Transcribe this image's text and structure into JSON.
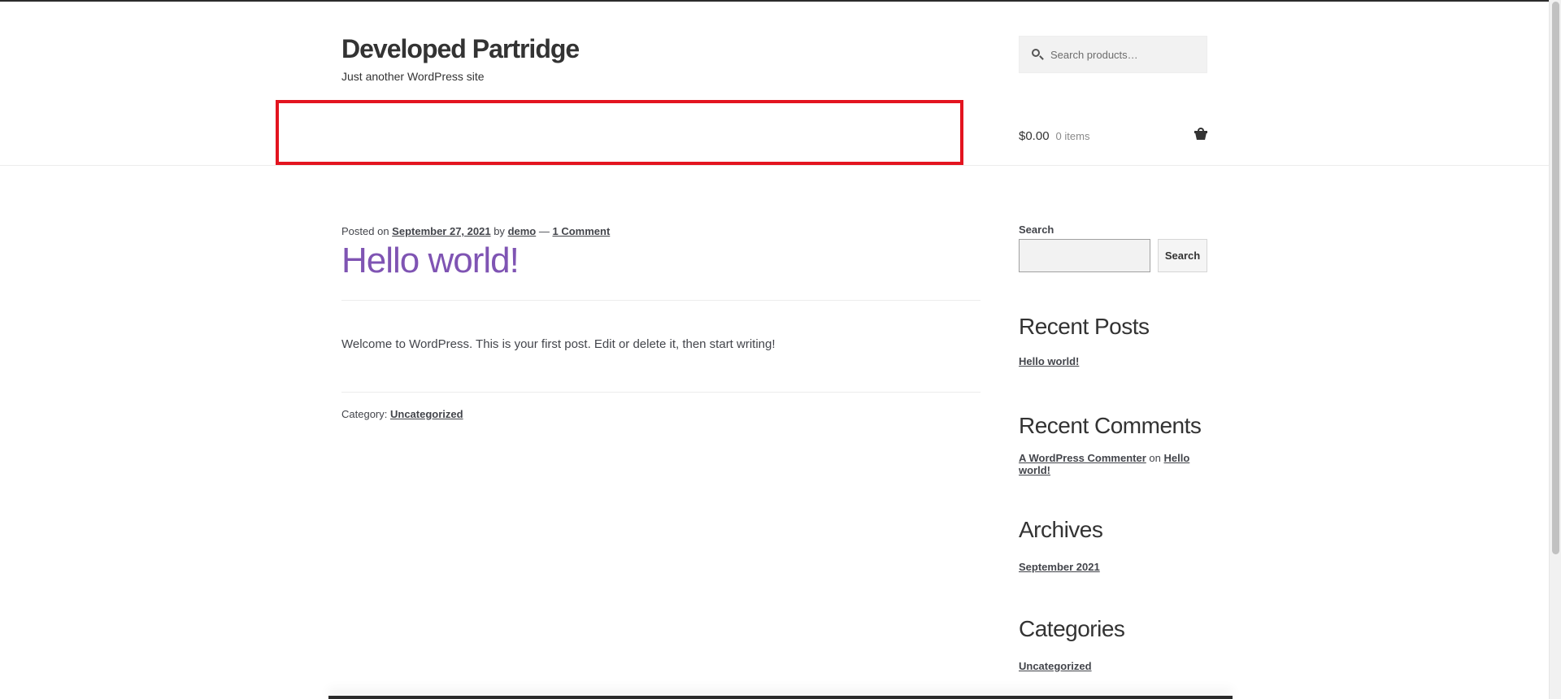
{
  "header": {
    "site_title": "Developed Partridge",
    "tagline": "Just another WordPress site",
    "search_placeholder": "Search products…",
    "cart_amount": "$0.00",
    "cart_count": "0 items"
  },
  "post": {
    "meta_prefix": "Posted on",
    "date": "September 27, 2021",
    "by_label": "by",
    "author": "demo",
    "dash": "—",
    "comments": "1 Comment",
    "title": "Hello world!",
    "body": "Welcome to WordPress. This is your first post. Edit or delete it, then start writing!",
    "category_label": "Category:",
    "category": "Uncategorized"
  },
  "sidebar": {
    "search_label": "Search",
    "search_button": "Search",
    "recent_posts_title": "Recent Posts",
    "recent_posts": [
      "Hello world!"
    ],
    "recent_comments_title": "Recent Comments",
    "comment_author": "A WordPress Commenter",
    "comment_on": "on",
    "comment_post": "Hello world!",
    "archives_title": "Archives",
    "archives": [
      "September 2021"
    ],
    "categories_title": "Categories",
    "categories": [
      "Uncategorized"
    ]
  },
  "colors": {
    "accent": "#7f54b3",
    "highlight": "#e3141f",
    "text": "#43454b"
  },
  "icons": [
    "search-icon",
    "basket-icon"
  ]
}
